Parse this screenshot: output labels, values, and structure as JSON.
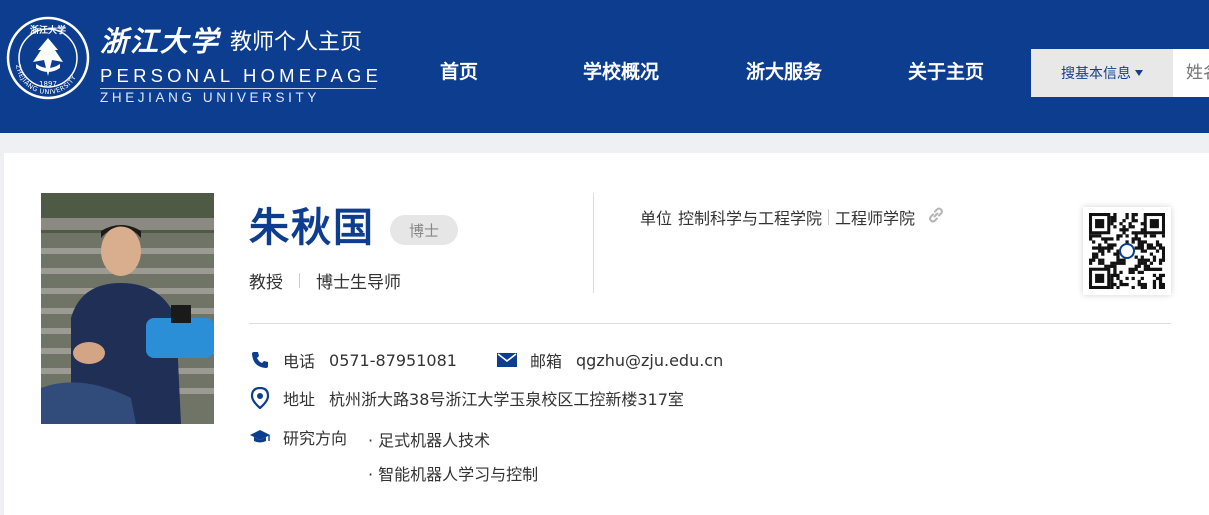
{
  "header": {
    "logo_cn_brand": "浙江大学",
    "logo_cn_sub": "教师个人主页",
    "logo_en_line1": "PERSONAL HOMEPAGE",
    "logo_en_line2": "ZHEJIANG UNIVERSITY",
    "seal_text": "ZHEJIANG UNIVERSITY",
    "seal_year": "1897"
  },
  "nav": {
    "items": [
      {
        "label": "首页"
      },
      {
        "label": "学校概况"
      },
      {
        "label": "浙大服务"
      },
      {
        "label": "关于主页"
      }
    ]
  },
  "search": {
    "scope_label": "搜基本信息",
    "placeholder": "姓名"
  },
  "profile": {
    "name": "朱秋国",
    "degree": "博士",
    "title": "教授",
    "role": "博士生导师",
    "unit_label": "单位",
    "unit_values": [
      "控制科学与工程学院",
      "工程师学院"
    ],
    "phone_label": "电话",
    "phone": "0571-87951081",
    "email_label": "邮箱",
    "email": "qgzhu@zju.edu.cn",
    "address_label": "地址",
    "address": "杭州浙大路38号浙江大学玉泉校区工控新楼317室",
    "research_label": "研究方向",
    "research": [
      "· 足式机器人技术",
      "· 智能机器人学习与控制"
    ]
  },
  "icons": {
    "phone": "phone-icon",
    "email": "mail-icon",
    "address": "location-pin-icon",
    "research": "graduation-cap-icon",
    "link": "link-icon",
    "caret": "caret-down-icon"
  },
  "colors": {
    "brand_blue": "#0d3d8f",
    "background": "#eef0f3",
    "card": "#ffffff"
  }
}
